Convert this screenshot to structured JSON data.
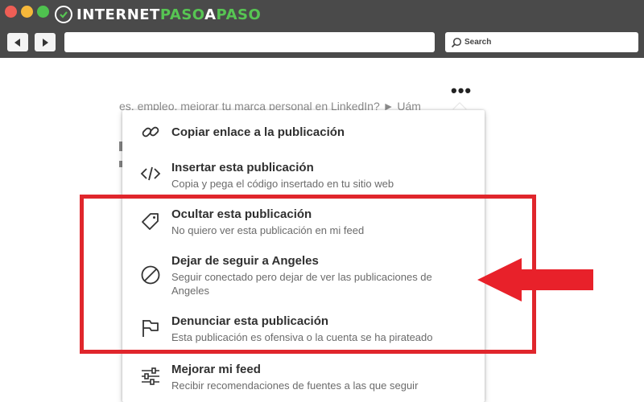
{
  "browser": {
    "brand": {
      "part1": "INTERNET",
      "part2": "PASO",
      "part3": "A",
      "part4": "PASO"
    },
    "search_placeholder": "Search",
    "icons": [
      "close-dot",
      "minimize-dot",
      "maximize-dot",
      "back-arrow-icon",
      "forward-arrow-icon",
      "search-icon"
    ]
  },
  "page": {
    "background_text": "es, empleo, mejorar tu marca personal en LinkedIn? ► Uám",
    "more_button": "•••"
  },
  "menu": {
    "items": [
      {
        "icon": "link-icon",
        "title": "Copiar enlace a la publicación",
        "subtitle": ""
      },
      {
        "icon": "code-icon",
        "title": "Insertar esta publicación",
        "subtitle": "Copia y pega el código insertado en tu sitio web"
      },
      {
        "icon": "tag-icon",
        "title": "Ocultar esta publicación",
        "subtitle": "No quiero ver esta publicación en mi feed"
      },
      {
        "icon": "block-icon",
        "title": "Dejar de seguir a Angeles",
        "subtitle": "Seguir conectado pero dejar de ver las publicaciones de Angeles"
      },
      {
        "icon": "flag-icon",
        "title": "Denunciar esta publicación",
        "subtitle": "Esta publicación es ofensiva o la cuenta se ha pirateado"
      },
      {
        "icon": "sliders-icon",
        "title": "Mejorar mi feed",
        "subtitle": "Recibir recomendaciones de fuentes a las que seguir"
      }
    ]
  },
  "annotation": {
    "highlight_color": "#e0262c",
    "arrow_color": "#e8212a"
  }
}
